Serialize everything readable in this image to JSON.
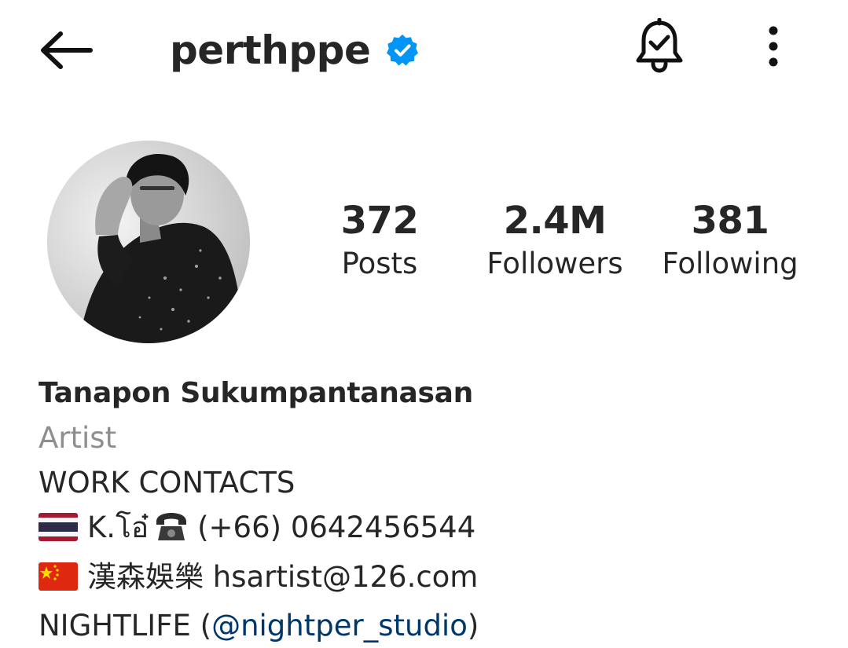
{
  "header": {
    "username": "perthppe",
    "verified": true,
    "back_icon": "arrow-left-icon",
    "bell_icon": "bell-check-icon",
    "more_icon": "more-vertical-icon"
  },
  "profile": {
    "avatar_icon": "profile-photo",
    "stats": {
      "posts": {
        "value": "372",
        "label": "Posts"
      },
      "followers": {
        "value": "2.4M",
        "label": "Followers"
      },
      "following": {
        "value": "381",
        "label": "Following"
      }
    }
  },
  "bio": {
    "name": "Tanapon Sukumpantanasan",
    "category": "Artist",
    "line1": "WORK CONTACTS",
    "thai_contact": {
      "flag": "thailand-flag",
      "name": "K.โอ๋",
      "phone_icon": "telephone-icon",
      "phone": "(+66) 0642456544"
    },
    "china_contact": {
      "flag": "china-flag",
      "company": "漢森娛樂",
      "email": "hsartist@126.com"
    },
    "nightlife": {
      "prefix": "NIGHTLIFE (",
      "mention": "@nightper_studio",
      "suffix": ")"
    }
  },
  "colors": {
    "text": "#262626",
    "muted": "#8e8e8e",
    "link": "#00376b",
    "verified": "#0095f6"
  }
}
